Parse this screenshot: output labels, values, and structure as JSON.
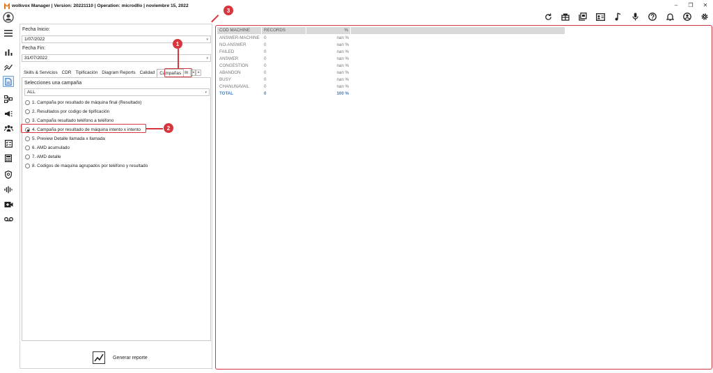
{
  "window": {
    "title": "wolkvox Manager  | Version: 20221110  |  Operation: microdllo | noviembre 15, 2022",
    "minimize": "–",
    "restore": "❐",
    "close": "✕"
  },
  "form": {
    "fecha_inicio_label": "Fecha Inicio:",
    "fecha_inicio_value": "1/07/2022",
    "fecha_fin_label": "Fecha Fin:",
    "fecha_fin_value": "31/07/2022"
  },
  "tabs": [
    "Skills & Servicios",
    "CDR",
    "Tipificación",
    "Diagram Reports",
    "Calidad",
    "Campañas",
    "In"
  ],
  "tab_selected": "Campañas",
  "campaign": {
    "label": "Selecciones una campaña",
    "selected": "ALL"
  },
  "reports": [
    {
      "label": "1. Campaña por resultado de máquina final (Resultado)",
      "checked": false
    },
    {
      "label": "2. Resultados por codigo de tipificación",
      "checked": false
    },
    {
      "label": "3. Campaña resultado teléfono a teléfono",
      "checked": false
    },
    {
      "label": "4. Campaña por resultado de máquina intento x intento",
      "checked": true
    },
    {
      "label": "5. Preview Detalle llamada x llamada",
      "checked": false
    },
    {
      "label": "6. AMD acumulado",
      "checked": false
    },
    {
      "label": "7. AMD detalle",
      "checked": false
    },
    {
      "label": "8. Codigos de maquina agrupados por teléfono y resultado",
      "checked": false
    }
  ],
  "generate_label": "Generar reporte",
  "grid": {
    "headers": [
      "COD MACHINE",
      "RECORDS",
      "%"
    ],
    "rows": [
      [
        "ANSWER-MACHINE",
        "0",
        "nan %"
      ],
      [
        "NO-ANSWER",
        "0",
        "nan %"
      ],
      [
        "FAILED",
        "0",
        "nan %"
      ],
      [
        "ANSWER",
        "0",
        "nan %"
      ],
      [
        "CONGESTION",
        "0",
        "nan %"
      ],
      [
        "ABANDON",
        "0",
        "nan %"
      ],
      [
        "BUSY",
        "0",
        "nan %"
      ],
      [
        "CHANUNAVAIL",
        "0",
        "nan %"
      ]
    ],
    "total": [
      "TOTAL",
      "0",
      "100 %"
    ]
  },
  "callouts": [
    "1",
    "2",
    "3"
  ],
  "colors": {
    "accent_red": "#d8363f",
    "total_blue": "#3d7fc4",
    "header_gray": "#d9d9d9"
  }
}
